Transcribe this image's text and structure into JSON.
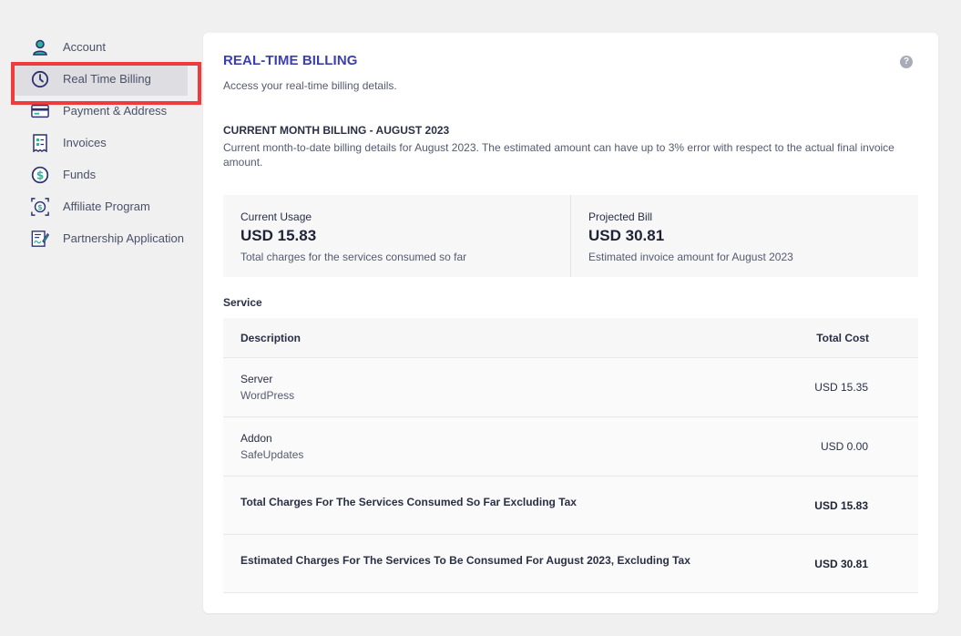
{
  "sidebar": {
    "items": [
      {
        "label": "Account",
        "icon": "user-icon"
      },
      {
        "label": "Real Time Billing",
        "icon": "clock-icon",
        "active": true
      },
      {
        "label": "Payment & Address",
        "icon": "credit-card-icon"
      },
      {
        "label": "Invoices",
        "icon": "invoice-icon"
      },
      {
        "label": "Funds",
        "icon": "dollar-coin-icon"
      },
      {
        "label": "Affiliate Program",
        "icon": "affiliate-icon"
      },
      {
        "label": "Partnership Application",
        "icon": "application-form-icon"
      }
    ]
  },
  "main": {
    "title": "REAL-TIME BILLING",
    "subtitle": "Access your real-time billing details.",
    "current_month": {
      "title": "CURRENT MONTH BILLING - AUGUST 2023",
      "description": "Current month-to-date billing details for August 2023. The estimated amount can have up to 3% error with respect to the actual final invoice amount."
    },
    "summary": {
      "current_usage": {
        "label": "Current Usage",
        "value": "USD 15.83",
        "note": "Total charges for the services consumed so far"
      },
      "projected_bill": {
        "label": "Projected Bill",
        "value": "USD 30.81",
        "note": "Estimated invoice amount for August 2023"
      }
    },
    "service_heading": "Service",
    "table": {
      "columns": [
        "Description",
        "Total Cost"
      ],
      "rows": [
        {
          "name": "Server",
          "detail": "WordPress",
          "cost": "USD 15.35"
        },
        {
          "name": "Addon",
          "detail": "SafeUpdates",
          "cost": "USD 0.00"
        }
      ],
      "totals": [
        {
          "label": "Total Charges For The Services Consumed So Far Excluding Tax",
          "cost": "USD 15.83"
        },
        {
          "label": "Estimated Charges For The Services To Be Consumed For August 2023, Excluding Tax",
          "cost": "USD 30.81"
        }
      ]
    }
  },
  "colors": {
    "accent": "#3b3fb0",
    "icon_green": "#2bb59a",
    "icon_navy": "#2b3170",
    "highlight_red": "#ef3b3b"
  }
}
